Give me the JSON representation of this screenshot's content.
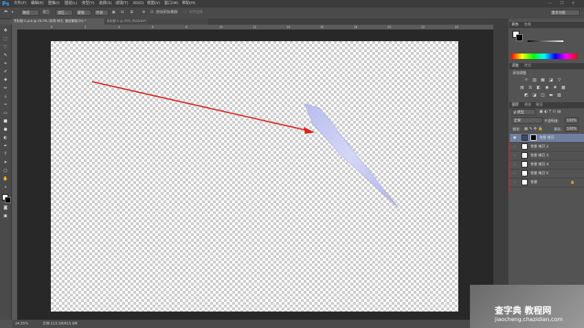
{
  "app": {
    "logo": "Ps"
  },
  "menubar": {
    "items": [
      "文件(F)",
      "编辑(E)",
      "图像(I)",
      "图层(L)",
      "类型(Y)",
      "选择(S)",
      "滤镜(T)",
      "3D(D)",
      "视图(V)",
      "窗口(W)",
      "帮助(H)"
    ]
  },
  "options": {
    "mode_value": "路径",
    "build_label": "建立:",
    "selection_button": "选区...",
    "mask_button": "蒙版",
    "shape_button": "形状",
    "auto_add_delete": "自动添加/删除",
    "align_edges": "对齐边缘",
    "workspace": "基本功能"
  },
  "document": {
    "tab_title": "无标题-1.psd @ 24.5% (背景 拷贝, 图层蒙版/16) *",
    "tab2_title": "未标题-1 @ 25% (RGB/8#)",
    "zoom": "24.55%",
    "doc_info": "文档:113.1M/615.6M"
  },
  "ruler": {
    "ticks": [
      "0",
      "2",
      "4",
      "6",
      "8",
      "10",
      "12",
      "14",
      "16",
      "18",
      "20",
      "22",
      "24"
    ]
  },
  "panels": {
    "color_tab": "颜色",
    "swatch_tab": "色板",
    "adjust_tab": "调整",
    "style_tab": "样式",
    "add_adjustment": "添加调整",
    "layers_tab": "图层",
    "channels_tab": "通道",
    "paths_tab": "路径",
    "kind_filter": "ρ 类型",
    "blend_mode": "正常",
    "opacity_label": "不透明度:",
    "opacity_value": "100%",
    "lock_label": "锁定:",
    "fill_label": "填充:",
    "fill_value": "100%"
  },
  "layers": [
    {
      "name": "背景 拷贝",
      "selected": true
    },
    {
      "name": "背景 拷贝 2",
      "selected": false
    },
    {
      "name": "背景 拷贝 3",
      "selected": false
    },
    {
      "name": "背景 拷贝 4",
      "selected": false
    },
    {
      "name": "背景 拷贝 5",
      "selected": false
    },
    {
      "name": "背景",
      "selected": false
    }
  ],
  "watermark": {
    "title": "查字典 教程网",
    "url": "jiaocheng.chazidian.com"
  },
  "colors": {
    "annotation_red": "#e02020",
    "shape_fill": "#c9ccf2",
    "highlight": "#6f7f9f"
  }
}
